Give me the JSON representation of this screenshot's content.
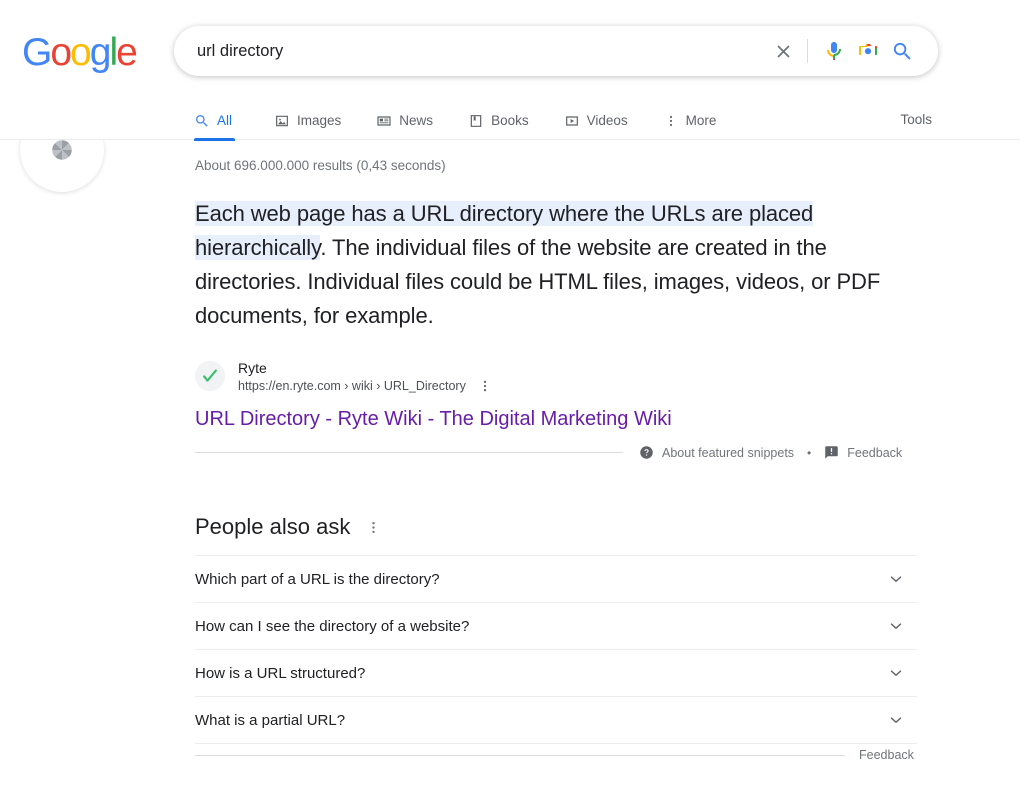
{
  "brand": {
    "logo_letters": [
      "G",
      "o",
      "o",
      "g",
      "l",
      "e"
    ],
    "colors": {
      "blue": "#4285f4",
      "red": "#ea4335",
      "yellow": "#fbbc05",
      "green": "#34a853",
      "link_visited": "#681da8",
      "accent": "#1a73e8",
      "highlight": "#e8effc"
    }
  },
  "search": {
    "query": "url directory",
    "placeholder": "Search",
    "clear_label": "Clear",
    "voice_label": "Search by voice",
    "lens_label": "Search by image",
    "submit_label": "Google Search"
  },
  "tabs": [
    {
      "label": "All",
      "icon": "search-icon",
      "active": true
    },
    {
      "label": "Images",
      "icon": "image-icon",
      "active": false
    },
    {
      "label": "News",
      "icon": "news-icon",
      "active": false
    },
    {
      "label": "Books",
      "icon": "book-icon",
      "active": false
    },
    {
      "label": "Videos",
      "icon": "video-icon",
      "active": false
    },
    {
      "label": "More",
      "icon": "more-vert-icon",
      "active": false
    }
  ],
  "tools_label": "Tools",
  "results": {
    "count_text": "About 696.000.000 results (0,43 seconds)"
  },
  "featured_snippet": {
    "highlighted_text": "Each web page has a URL directory where the URLs are placed hierarchically",
    "rest_text": ". The individual files of the website are created in the directories. Individual files could be HTML files, images, videos, or PDF documents, for example.",
    "source_name": "Ryte",
    "source_url": "https://en.ryte.com › wiki › URL_Directory",
    "result_title": "URL Directory - Ryte Wiki - The Digital Marketing Wiki",
    "about_label": "About featured snippets",
    "separator": "•",
    "feedback_label": "Feedback"
  },
  "people_also_ask": {
    "title": "People also ask",
    "questions": [
      "Which part of a URL is the directory?",
      "How can I see the directory of a website?",
      "How is a URL structured?",
      "What is a partial URL?"
    ],
    "feedback_label": "Feedback"
  }
}
